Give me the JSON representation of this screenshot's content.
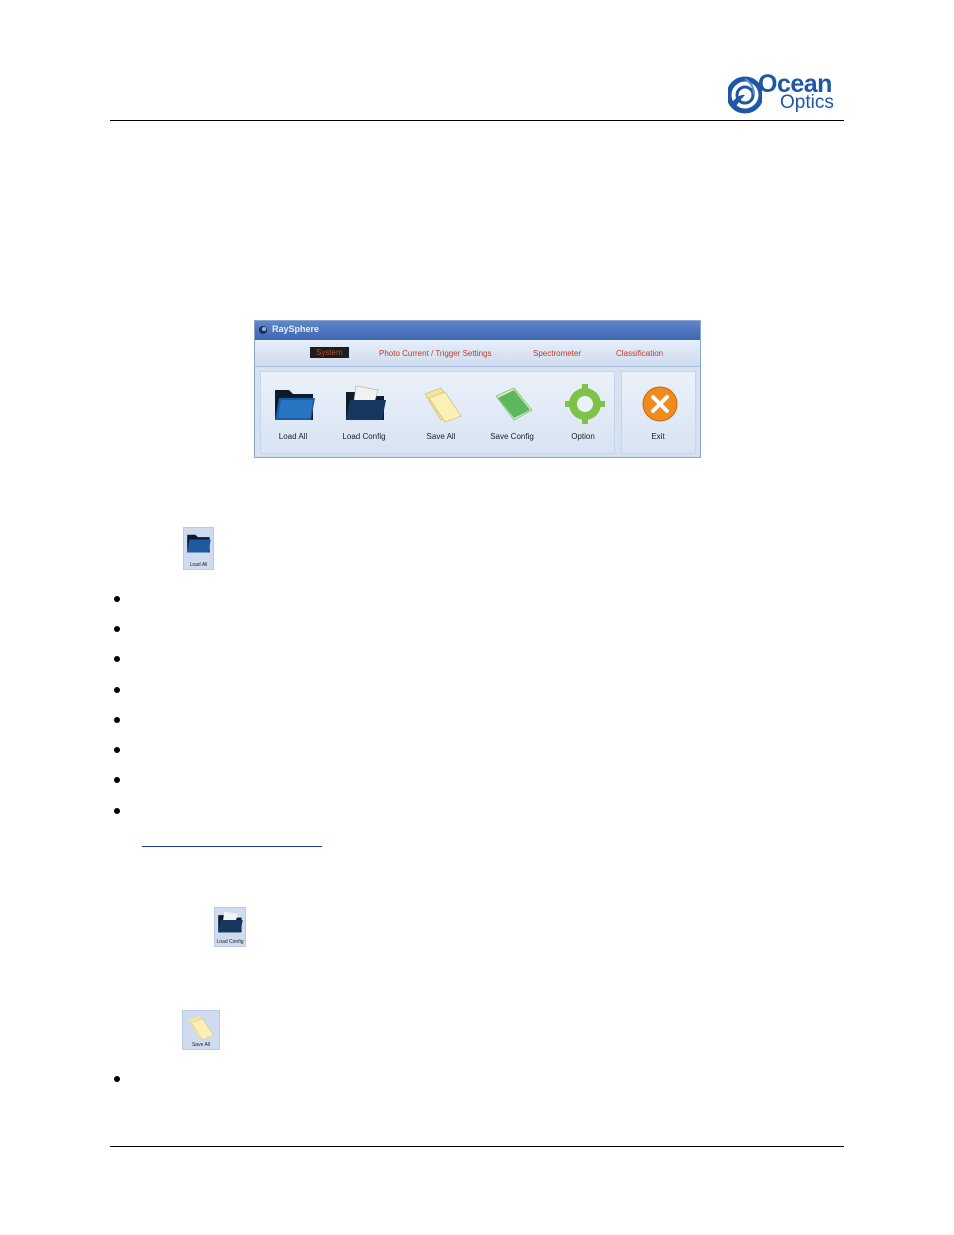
{
  "header": {
    "logo_word1": "Ocean",
    "logo_word2": "Optics"
  },
  "raysphere": {
    "title": "RaySphere",
    "tabs": [
      "System",
      "Photo Current / Trigger Settings",
      "Spectrometer",
      "Classification"
    ],
    "buttons": [
      "Load All",
      "Load Config",
      "Save All",
      "Save Config",
      "Option",
      "Exit"
    ]
  },
  "thumbnails": {
    "load_all": "Load All",
    "load_config": "Load Config",
    "save_all": "Save All"
  },
  "colors": {
    "logo_blue": "#1d57a6",
    "titlebar": "#4a72b8",
    "tab_text": "#c0392b",
    "exit_orange": "#f08a1c"
  }
}
